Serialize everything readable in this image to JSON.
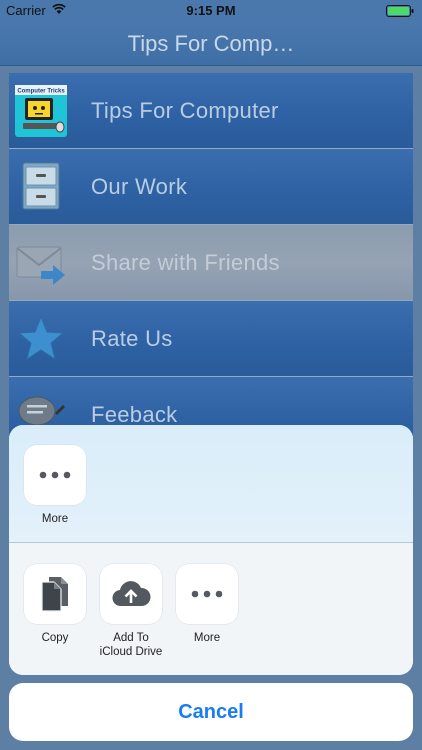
{
  "status_bar": {
    "carrier": "Carrier",
    "time": "9:15 PM"
  },
  "nav": {
    "title": "Tips For Comp…"
  },
  "menu": {
    "items": [
      {
        "label": "Tips For Computer",
        "icon": "computer-tricks-icon"
      },
      {
        "label": "Our Work",
        "icon": "cabinet-icon"
      },
      {
        "label": "Share with Friends",
        "icon": "mail-forward-icon"
      },
      {
        "label": "Rate Us",
        "icon": "star-icon"
      },
      {
        "label": "Feeback",
        "icon": "feedback-icon"
      }
    ],
    "icon_logo_text": "Computer Tricks"
  },
  "share_sheet": {
    "row1": [
      {
        "label": "More",
        "icon": "more-icon"
      }
    ],
    "row2": [
      {
        "label": "Copy",
        "icon": "copy-icon"
      },
      {
        "label": "Add To iCloud Drive",
        "line1": "Add To",
        "line2": "iCloud Drive",
        "icon": "cloud-upload-icon"
      },
      {
        "label": "More",
        "icon": "more-icon"
      }
    ]
  },
  "cancel": {
    "label": "Cancel"
  },
  "colors": {
    "accent": "#1a7cf5",
    "nav": "#4a78ad",
    "menu": "#2e62a4"
  }
}
